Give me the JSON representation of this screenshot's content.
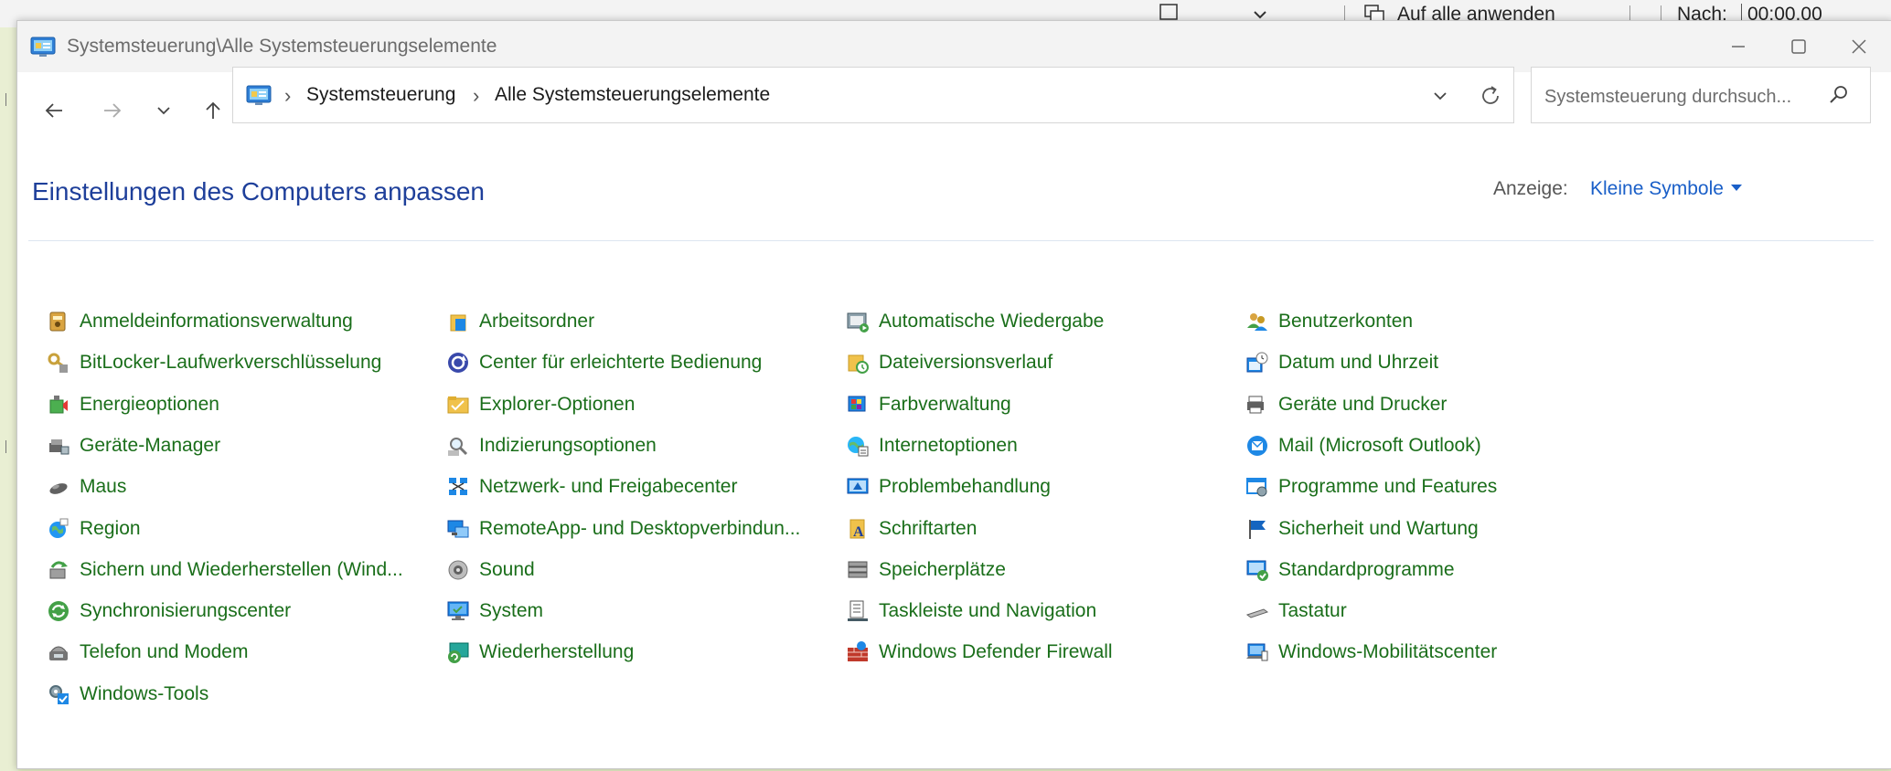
{
  "background": {
    "apply_all": "Auf alle anwenden",
    "after_label": "Nach:",
    "after_value": "00:00.00"
  },
  "window": {
    "title": "Systemsteuerung\\Alle Systemsteuerungselemente"
  },
  "address": {
    "crumbs": [
      "Systemsteuerung",
      "Alle Systemsteuerungselemente"
    ]
  },
  "search": {
    "placeholder": "Systemsteuerung durchsuch..."
  },
  "page": {
    "heading": "Einstellungen des Computers anpassen",
    "view_label": "Anzeige:",
    "view_value": "Kleine Symbole"
  },
  "colors": {
    "link_green": "#1a6e1a",
    "heading_blue": "#1e3f9a",
    "accent_blue": "#1a5fc8"
  },
  "columns": [
    {
      "items": [
        {
          "label": "Anmeldeinformationsverwaltung",
          "icon": "credential-manager-icon"
        },
        {
          "label": "BitLocker-Laufwerkverschlüsselung",
          "icon": "bitlocker-icon"
        },
        {
          "label": "Energieoptionen",
          "icon": "power-options-icon"
        },
        {
          "label": "Geräte-Manager",
          "icon": "device-manager-icon"
        },
        {
          "label": "Maus",
          "icon": "mouse-icon"
        },
        {
          "label": "Region",
          "icon": "region-icon"
        },
        {
          "label": "Sichern und Wiederherstellen (Wind...",
          "icon": "backup-restore-icon"
        },
        {
          "label": "Synchronisierungscenter",
          "icon": "sync-center-icon"
        },
        {
          "label": "Telefon und Modem",
          "icon": "phone-modem-icon"
        },
        {
          "label": "Windows-Tools",
          "icon": "windows-tools-icon"
        }
      ]
    },
    {
      "items": [
        {
          "label": "Arbeitsordner",
          "icon": "work-folders-icon"
        },
        {
          "label": "Center für erleichterte Bedienung",
          "icon": "ease-of-access-icon"
        },
        {
          "label": "Explorer-Optionen",
          "icon": "explorer-options-icon"
        },
        {
          "label": "Indizierungsoptionen",
          "icon": "indexing-options-icon"
        },
        {
          "label": "Netzwerk- und Freigabecenter",
          "icon": "network-sharing-icon"
        },
        {
          "label": "RemoteApp- und Desktopverbindun...",
          "icon": "remoteapp-icon"
        },
        {
          "label": "Sound",
          "icon": "sound-icon"
        },
        {
          "label": "System",
          "icon": "system-icon"
        },
        {
          "label": "Wiederherstellung",
          "icon": "recovery-icon"
        }
      ]
    },
    {
      "items": [
        {
          "label": "Automatische Wiedergabe",
          "icon": "autoplay-icon"
        },
        {
          "label": "Dateiversionsverlauf",
          "icon": "file-history-icon"
        },
        {
          "label": "Farbverwaltung",
          "icon": "color-management-icon"
        },
        {
          "label": "Internetoptionen",
          "icon": "internet-options-icon"
        },
        {
          "label": "Problembehandlung",
          "icon": "troubleshooting-icon"
        },
        {
          "label": "Schriftarten",
          "icon": "fonts-icon"
        },
        {
          "label": "Speicherplätze",
          "icon": "storage-spaces-icon"
        },
        {
          "label": "Taskleiste und Navigation",
          "icon": "taskbar-icon"
        },
        {
          "label": "Windows Defender Firewall",
          "icon": "firewall-icon"
        }
      ]
    },
    {
      "items": [
        {
          "label": "Benutzerkonten",
          "icon": "user-accounts-icon"
        },
        {
          "label": "Datum und Uhrzeit",
          "icon": "date-time-icon"
        },
        {
          "label": "Geräte und Drucker",
          "icon": "devices-printers-icon"
        },
        {
          "label": "Mail (Microsoft Outlook)",
          "icon": "mail-icon"
        },
        {
          "label": "Programme und Features",
          "icon": "programs-features-icon"
        },
        {
          "label": "Sicherheit und Wartung",
          "icon": "security-maintenance-icon"
        },
        {
          "label": "Standardprogramme",
          "icon": "default-programs-icon"
        },
        {
          "label": "Tastatur",
          "icon": "keyboard-icon"
        },
        {
          "label": "Windows-Mobilitätscenter",
          "icon": "mobility-center-icon"
        }
      ]
    }
  ]
}
